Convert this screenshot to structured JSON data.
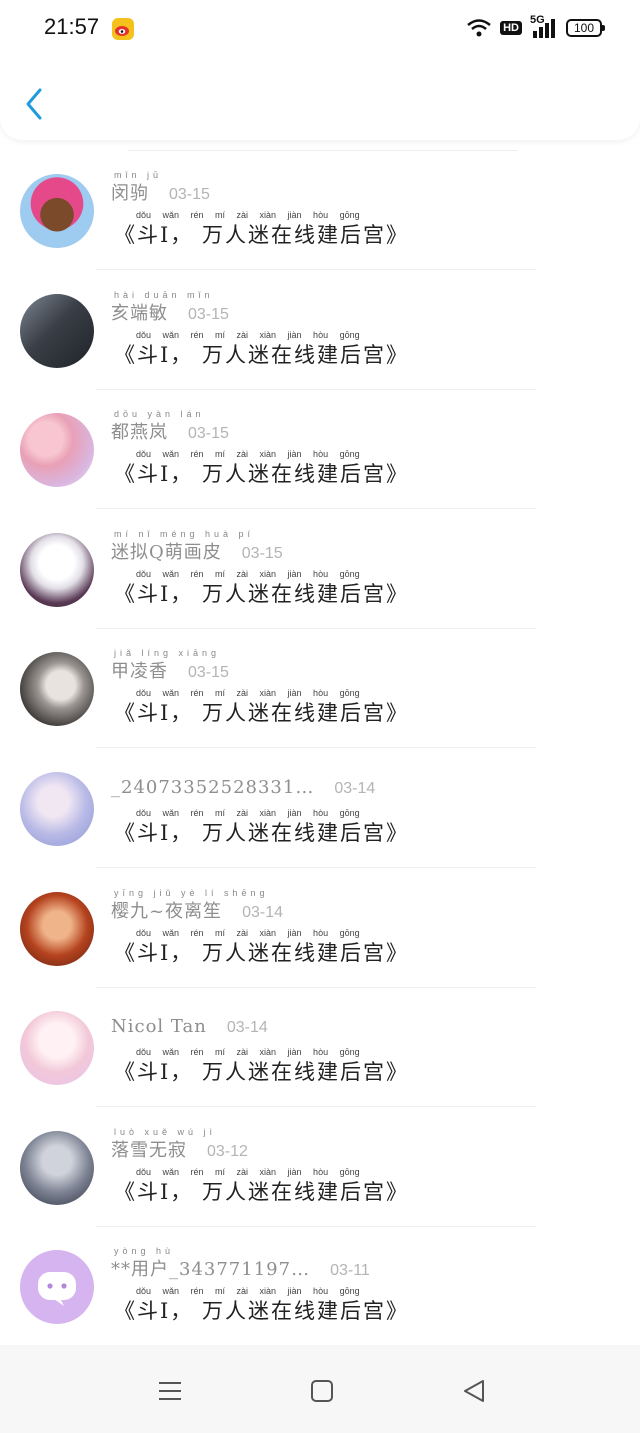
{
  "status_bar": {
    "time": "21:57",
    "net": "5G",
    "hd": "HD",
    "battery": "100"
  },
  "header": {
    "back_icon": "chevron-left-icon",
    "accent": "#1f9bde"
  },
  "comment": {
    "pinyin": "dǒu  wǎn rén mí zài xiàn jiàn hòu gōng",
    "text": "《斗I， 万人迷在线建后宫》"
  },
  "items": [
    {
      "name": "闵驹",
      "pinyin": "mǐn jū",
      "date": "03-15",
      "avatar": "avatar-1"
    },
    {
      "name": "亥端敏",
      "pinyin": "hài duān mǐn",
      "date": "03-15",
      "avatar": "avatar-2"
    },
    {
      "name": "都燕岚",
      "pinyin": "dōu yàn lán",
      "date": "03-15",
      "avatar": "avatar-3"
    },
    {
      "name": "迷拟Q萌画皮",
      "pinyin": "mí nǐ  méng huà pí",
      "date": "03-15",
      "avatar": "avatar-4"
    },
    {
      "name": "甲凌香",
      "pinyin": "jiǎ líng xiāng",
      "date": "03-15",
      "avatar": "avatar-5"
    },
    {
      "name": "_24073352528331…",
      "pinyin": "",
      "date": "03-14",
      "avatar": "avatar-6"
    },
    {
      "name": "樱九~夜离笙",
      "pinyin": "yīng jiǔ  yè lí shēng",
      "date": "03-14",
      "avatar": "avatar-7"
    },
    {
      "name": "Nicol Tan",
      "pinyin": "",
      "date": "03-14",
      "avatar": "avatar-8"
    },
    {
      "name": "落雪无寂",
      "pinyin": "luò xuě wú jì",
      "date": "03-12",
      "avatar": "avatar-9"
    },
    {
      "name": "**用户_343771197…",
      "pinyin": "  yòng hù",
      "date": "03-11",
      "avatar": "avatar-10"
    }
  ],
  "nav": {
    "menu_icon": "menu-icon",
    "home_icon": "home-square-icon",
    "back_icon": "triangle-back-icon"
  }
}
